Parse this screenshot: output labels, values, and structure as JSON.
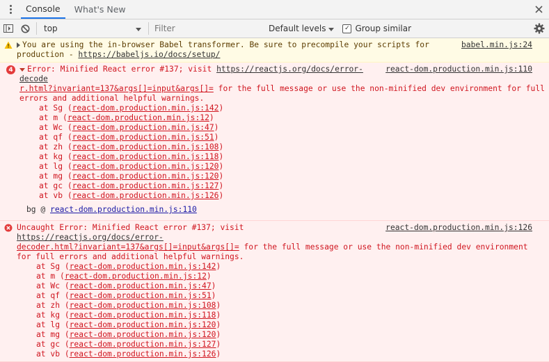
{
  "tabs": [
    {
      "label": "Console",
      "active": true
    },
    {
      "label": "What's New",
      "active": false
    }
  ],
  "toolbar": {
    "context": "top",
    "filter_placeholder": "Filter",
    "levels_label": "Default levels",
    "group_label": "Group similar",
    "group_checked": true
  },
  "messages": {
    "warning": {
      "prefix": "You are using the in-browser Babel transformer. Be sure to precompile your scripts for production - ",
      "link": "https://babeljs.io/docs/setup/",
      "source": "babel.min.js:24"
    },
    "error1": {
      "count": "4",
      "text_a": "Error: Minified React error #137; visit ",
      "link_a": "https://reactjs.org/docs/error-decode",
      "link_b": "r.html?invariant=137&args[]=input&args[]=",
      "text_b": " for the full message or use the non-minified dev environment for full errors and additional helpful warnings.",
      "source": "react-dom.production.min.js:110",
      "stack": [
        {
          "fn": "Sg",
          "loc": "react-dom.production.min.js:142"
        },
        {
          "fn": "m",
          "loc": "react-dom.production.min.js:12"
        },
        {
          "fn": "Wc",
          "loc": "react-dom.production.min.js:47"
        },
        {
          "fn": "qf",
          "loc": "react-dom.production.min.js:51"
        },
        {
          "fn": "zh",
          "loc": "react-dom.production.min.js:108"
        },
        {
          "fn": "kg",
          "loc": "react-dom.production.min.js:118"
        },
        {
          "fn": "lg",
          "loc": "react-dom.production.min.js:120"
        },
        {
          "fn": "mg",
          "loc": "react-dom.production.min.js:120"
        },
        {
          "fn": "gc",
          "loc": "react-dom.production.min.js:127"
        },
        {
          "fn": "vb",
          "loc": "react-dom.production.min.js:126"
        }
      ],
      "bg_prefix": "bg @ ",
      "bg_link": "react-dom.production.min.js:110"
    },
    "error2": {
      "text_a": "Uncaught Error: Minified React error #137; visit ",
      "link_a": "https://reactjs.org/docs/error-",
      "link_b": "decoder.html?invariant=137&args[]=input&args[]=",
      "text_b": " for the full message or use the non-minified dev environment for full errors and additional helpful warnings.",
      "source": "react-dom.production.min.js:126",
      "stack": [
        {
          "fn": "Sg",
          "loc": "react-dom.production.min.js:142"
        },
        {
          "fn": "m",
          "loc": "react-dom.production.min.js:12"
        },
        {
          "fn": "Wc",
          "loc": "react-dom.production.min.js:47"
        },
        {
          "fn": "qf",
          "loc": "react-dom.production.min.js:51"
        },
        {
          "fn": "zh",
          "loc": "react-dom.production.min.js:108"
        },
        {
          "fn": "kg",
          "loc": "react-dom.production.min.js:118"
        },
        {
          "fn": "lg",
          "loc": "react-dom.production.min.js:120"
        },
        {
          "fn": "mg",
          "loc": "react-dom.production.min.js:120"
        },
        {
          "fn": "gc",
          "loc": "react-dom.production.min.js:127"
        },
        {
          "fn": "vb",
          "loc": "react-dom.production.min.js:126"
        }
      ]
    }
  },
  "colors": {
    "accent": "#1a73e8",
    "error_text": "#d0151f",
    "error_bg": "#fff0f0",
    "warning_bg": "#fffbe5"
  }
}
